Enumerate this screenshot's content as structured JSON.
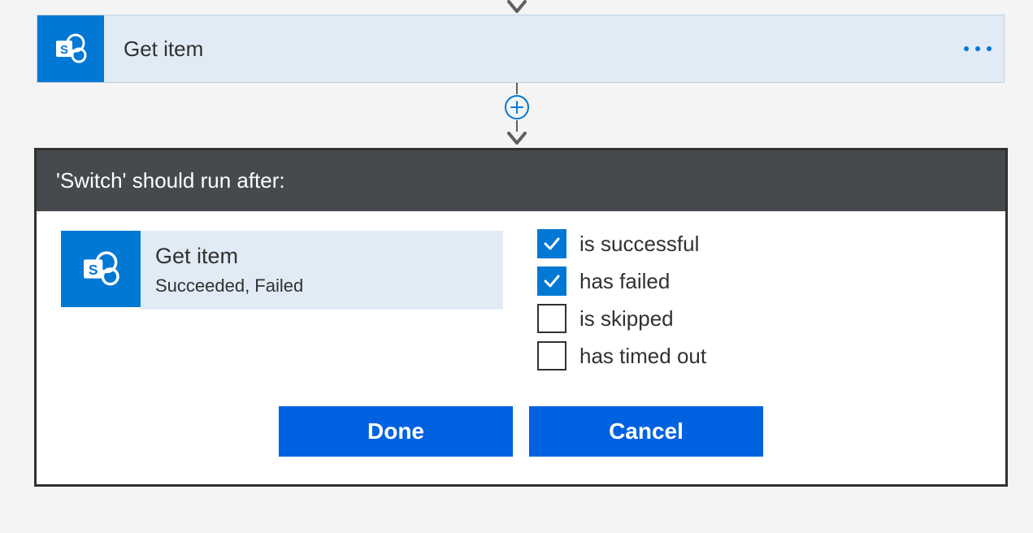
{
  "action": {
    "title": "Get item"
  },
  "panel": {
    "header": "'Switch' should run after:",
    "dependency": {
      "title": "Get item",
      "status": "Succeeded, Failed"
    },
    "checks": {
      "successful": {
        "label": "is successful",
        "checked": true
      },
      "failed": {
        "label": "has failed",
        "checked": true
      },
      "skipped": {
        "label": "is skipped",
        "checked": false
      },
      "timedout": {
        "label": "has timed out",
        "checked": false
      }
    },
    "buttons": {
      "done": "Done",
      "cancel": "Cancel"
    }
  }
}
